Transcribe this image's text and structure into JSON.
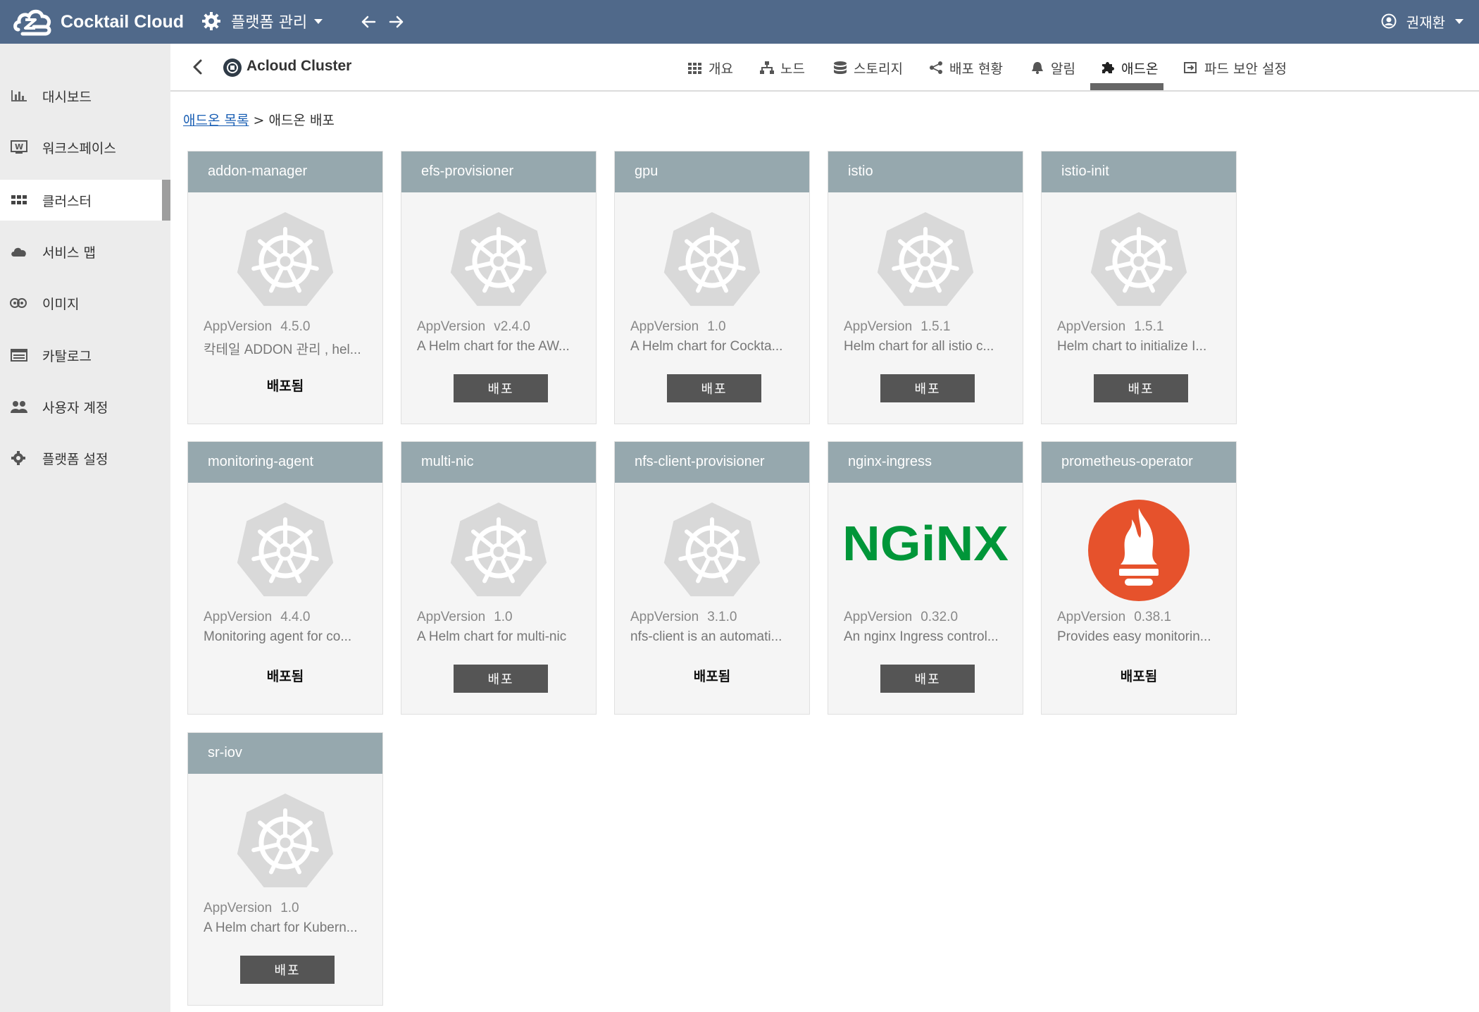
{
  "app": {
    "brand": "Cocktail Cloud",
    "platform_menu": "플랫폼 관리",
    "user": "권재환"
  },
  "sidebar": {
    "items": [
      {
        "label": "대시보드",
        "icon": "bar-chart-icon"
      },
      {
        "label": "워크스페이스",
        "icon": "workspace-icon"
      },
      {
        "label": "클러스터",
        "icon": "grid-icon"
      },
      {
        "label": "서비스 맵",
        "icon": "cloud-icon"
      },
      {
        "label": "이미지",
        "icon": "images-icon"
      },
      {
        "label": "카탈로그",
        "icon": "list-icon"
      },
      {
        "label": "사용자 계정",
        "icon": "users-icon"
      },
      {
        "label": "플랫폼 설정",
        "icon": "gear-icon"
      }
    ],
    "active_index": 2
  },
  "cluster": {
    "name": "Acloud Cluster",
    "tabs": [
      {
        "label": "개요",
        "icon": "grid-icon"
      },
      {
        "label": "노드",
        "icon": "sitemap-icon"
      },
      {
        "label": "스토리지",
        "icon": "database-icon"
      },
      {
        "label": "배포 현황",
        "icon": "share-icon"
      },
      {
        "label": "알림",
        "icon": "bell-icon"
      },
      {
        "label": "애드온",
        "icon": "puzzle-icon"
      },
      {
        "label": "파드 보안 설정",
        "icon": "sign-in-icon"
      }
    ],
    "active_tab": "애드온"
  },
  "breadcrumb": {
    "link": "애드온 목록",
    "separator": ">",
    "current": "애드온 배포"
  },
  "labels": {
    "app_version": "AppVersion",
    "deploy": "배포",
    "deployed": "배포됨"
  },
  "addons": [
    {
      "name": "addon-manager",
      "version": "4.5.0",
      "description": "칵테일 ADDON 관리 , hel...",
      "status": "deployed",
      "logo": "helm-wheel-icon"
    },
    {
      "name": "efs-provisioner",
      "version": "v2.4.0",
      "description": "A Helm chart for the AW...",
      "status": "available",
      "logo": "helm-wheel-icon"
    },
    {
      "name": "gpu",
      "version": "1.0",
      "description": "A Helm chart for Cockta...",
      "status": "available",
      "logo": "helm-wheel-icon"
    },
    {
      "name": "istio",
      "version": "1.5.1",
      "description": "Helm chart for all istio c...",
      "status": "available",
      "logo": "helm-wheel-icon"
    },
    {
      "name": "istio-init",
      "version": "1.5.1",
      "description": "Helm chart to initialize I...",
      "status": "available",
      "logo": "helm-wheel-icon"
    },
    {
      "name": "monitoring-agent",
      "version": "4.4.0",
      "description": "Monitoring agent for co...",
      "status": "deployed",
      "logo": "helm-wheel-icon"
    },
    {
      "name": "multi-nic",
      "version": "1.0",
      "description": "A Helm chart for multi-nic",
      "status": "available",
      "logo": "helm-wheel-icon"
    },
    {
      "name": "nfs-client-provisioner",
      "version": "3.1.0",
      "description": "nfs-client is an automati...",
      "status": "deployed",
      "logo": "helm-wheel-icon"
    },
    {
      "name": "nginx-ingress",
      "version": "0.32.0",
      "description": "An nginx Ingress control...",
      "status": "available",
      "logo": "nginx-logo",
      "logo_text": "NGiNX",
      "logo_color": "#009639"
    },
    {
      "name": "prometheus-operator",
      "version": "0.38.1",
      "description": "Provides easy monitorin...",
      "status": "deployed",
      "logo": "prometheus-logo",
      "logo_color": "#e6522c"
    },
    {
      "name": "sr-iov",
      "version": "1.0",
      "description": "A Helm chart for Kubern...",
      "status": "available",
      "logo": "helm-wheel-icon"
    }
  ],
  "colors": {
    "topbar": "#50698a",
    "sidebar": "#ececec",
    "card_header": "#96a8ae",
    "deploy_button": "#555555",
    "link": "#1a5fb4"
  }
}
